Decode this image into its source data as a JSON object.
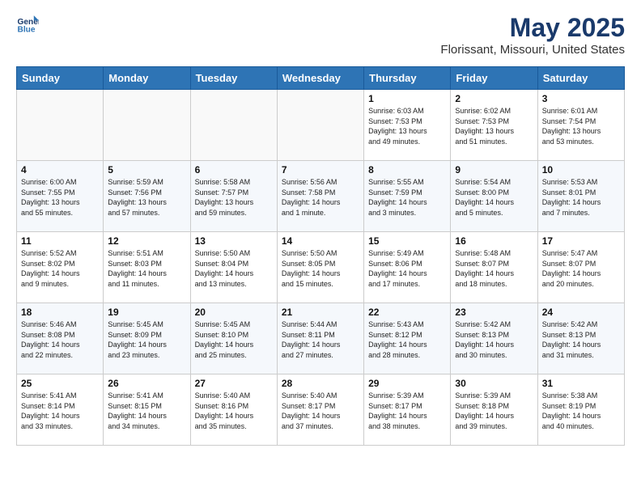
{
  "header": {
    "logo_line1": "General",
    "logo_line2": "Blue",
    "title": "May 2025",
    "subtitle": "Florissant, Missouri, United States"
  },
  "weekdays": [
    "Sunday",
    "Monday",
    "Tuesday",
    "Wednesday",
    "Thursday",
    "Friday",
    "Saturday"
  ],
  "weeks": [
    [
      {
        "day": "",
        "info": ""
      },
      {
        "day": "",
        "info": ""
      },
      {
        "day": "",
        "info": ""
      },
      {
        "day": "",
        "info": ""
      },
      {
        "day": "1",
        "info": "Sunrise: 6:03 AM\nSunset: 7:53 PM\nDaylight: 13 hours\nand 49 minutes."
      },
      {
        "day": "2",
        "info": "Sunrise: 6:02 AM\nSunset: 7:53 PM\nDaylight: 13 hours\nand 51 minutes."
      },
      {
        "day": "3",
        "info": "Sunrise: 6:01 AM\nSunset: 7:54 PM\nDaylight: 13 hours\nand 53 minutes."
      }
    ],
    [
      {
        "day": "4",
        "info": "Sunrise: 6:00 AM\nSunset: 7:55 PM\nDaylight: 13 hours\nand 55 minutes."
      },
      {
        "day": "5",
        "info": "Sunrise: 5:59 AM\nSunset: 7:56 PM\nDaylight: 13 hours\nand 57 minutes."
      },
      {
        "day": "6",
        "info": "Sunrise: 5:58 AM\nSunset: 7:57 PM\nDaylight: 13 hours\nand 59 minutes."
      },
      {
        "day": "7",
        "info": "Sunrise: 5:56 AM\nSunset: 7:58 PM\nDaylight: 14 hours\nand 1 minute."
      },
      {
        "day": "8",
        "info": "Sunrise: 5:55 AM\nSunset: 7:59 PM\nDaylight: 14 hours\nand 3 minutes."
      },
      {
        "day": "9",
        "info": "Sunrise: 5:54 AM\nSunset: 8:00 PM\nDaylight: 14 hours\nand 5 minutes."
      },
      {
        "day": "10",
        "info": "Sunrise: 5:53 AM\nSunset: 8:01 PM\nDaylight: 14 hours\nand 7 minutes."
      }
    ],
    [
      {
        "day": "11",
        "info": "Sunrise: 5:52 AM\nSunset: 8:02 PM\nDaylight: 14 hours\nand 9 minutes."
      },
      {
        "day": "12",
        "info": "Sunrise: 5:51 AM\nSunset: 8:03 PM\nDaylight: 14 hours\nand 11 minutes."
      },
      {
        "day": "13",
        "info": "Sunrise: 5:50 AM\nSunset: 8:04 PM\nDaylight: 14 hours\nand 13 minutes."
      },
      {
        "day": "14",
        "info": "Sunrise: 5:50 AM\nSunset: 8:05 PM\nDaylight: 14 hours\nand 15 minutes."
      },
      {
        "day": "15",
        "info": "Sunrise: 5:49 AM\nSunset: 8:06 PM\nDaylight: 14 hours\nand 17 minutes."
      },
      {
        "day": "16",
        "info": "Sunrise: 5:48 AM\nSunset: 8:07 PM\nDaylight: 14 hours\nand 18 minutes."
      },
      {
        "day": "17",
        "info": "Sunrise: 5:47 AM\nSunset: 8:07 PM\nDaylight: 14 hours\nand 20 minutes."
      }
    ],
    [
      {
        "day": "18",
        "info": "Sunrise: 5:46 AM\nSunset: 8:08 PM\nDaylight: 14 hours\nand 22 minutes."
      },
      {
        "day": "19",
        "info": "Sunrise: 5:45 AM\nSunset: 8:09 PM\nDaylight: 14 hours\nand 23 minutes."
      },
      {
        "day": "20",
        "info": "Sunrise: 5:45 AM\nSunset: 8:10 PM\nDaylight: 14 hours\nand 25 minutes."
      },
      {
        "day": "21",
        "info": "Sunrise: 5:44 AM\nSunset: 8:11 PM\nDaylight: 14 hours\nand 27 minutes."
      },
      {
        "day": "22",
        "info": "Sunrise: 5:43 AM\nSunset: 8:12 PM\nDaylight: 14 hours\nand 28 minutes."
      },
      {
        "day": "23",
        "info": "Sunrise: 5:42 AM\nSunset: 8:13 PM\nDaylight: 14 hours\nand 30 minutes."
      },
      {
        "day": "24",
        "info": "Sunrise: 5:42 AM\nSunset: 8:13 PM\nDaylight: 14 hours\nand 31 minutes."
      }
    ],
    [
      {
        "day": "25",
        "info": "Sunrise: 5:41 AM\nSunset: 8:14 PM\nDaylight: 14 hours\nand 33 minutes."
      },
      {
        "day": "26",
        "info": "Sunrise: 5:41 AM\nSunset: 8:15 PM\nDaylight: 14 hours\nand 34 minutes."
      },
      {
        "day": "27",
        "info": "Sunrise: 5:40 AM\nSunset: 8:16 PM\nDaylight: 14 hours\nand 35 minutes."
      },
      {
        "day": "28",
        "info": "Sunrise: 5:40 AM\nSunset: 8:17 PM\nDaylight: 14 hours\nand 37 minutes."
      },
      {
        "day": "29",
        "info": "Sunrise: 5:39 AM\nSunset: 8:17 PM\nDaylight: 14 hours\nand 38 minutes."
      },
      {
        "day": "30",
        "info": "Sunrise: 5:39 AM\nSunset: 8:18 PM\nDaylight: 14 hours\nand 39 minutes."
      },
      {
        "day": "31",
        "info": "Sunrise: 5:38 AM\nSunset: 8:19 PM\nDaylight: 14 hours\nand 40 minutes."
      }
    ]
  ]
}
